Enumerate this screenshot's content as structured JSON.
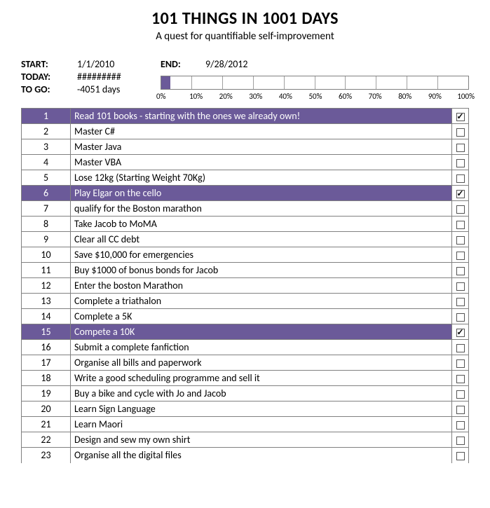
{
  "title": "101 THINGS IN 1001 DAYS",
  "subtitle": "A quest for quantifiable self-improvement",
  "meta": {
    "start_label": "START:",
    "start_value": "1/1/2010",
    "today_label": "TODAY:",
    "today_value": "#########",
    "togo_label": "TO GO:",
    "togo_value": "-4051 days",
    "end_label": "END:",
    "end_value": "9/28/2012"
  },
  "progress": {
    "ticks": [
      "0%",
      "10%",
      "20%",
      "30%",
      "40%",
      "50%",
      "60%",
      "70%",
      "80%",
      "90%",
      "100%"
    ],
    "fill_percent": 3
  },
  "items": [
    {
      "n": 1,
      "text": "Read 101 books - starting with the ones we already own!",
      "done": true
    },
    {
      "n": 2,
      "text": "Master C#",
      "done": false
    },
    {
      "n": 3,
      "text": "Master Java",
      "done": false
    },
    {
      "n": 4,
      "text": "Master VBA",
      "done": false
    },
    {
      "n": 5,
      "text": "Lose 12kg (Starting Weight 70Kg)",
      "done": false
    },
    {
      "n": 6,
      "text": "Play Elgar on the cello",
      "done": true
    },
    {
      "n": 7,
      "text": "qualify for the Boston marathon",
      "done": false
    },
    {
      "n": 8,
      "text": "Take Jacob to MoMA",
      "done": false
    },
    {
      "n": 9,
      "text": "Clear all CC debt",
      "done": false
    },
    {
      "n": 10,
      "text": "Save $10,000 for emergencies",
      "done": false
    },
    {
      "n": 11,
      "text": "Buy $1000 of bonus bonds for Jacob",
      "done": false
    },
    {
      "n": 12,
      "text": "Enter the boston Marathon",
      "done": false
    },
    {
      "n": 13,
      "text": "Complete a triathalon",
      "done": false
    },
    {
      "n": 14,
      "text": "Complete a 5K",
      "done": false
    },
    {
      "n": 15,
      "text": "Compete a 10K",
      "done": true
    },
    {
      "n": 16,
      "text": "Submit a complete fanfiction",
      "done": false
    },
    {
      "n": 17,
      "text": "Organise all bills and paperwork",
      "done": false
    },
    {
      "n": 18,
      "text": "Write a good scheduling programme and sell it",
      "done": false
    },
    {
      "n": 19,
      "text": "Buy a bike and cycle with Jo and Jacob",
      "done": false
    },
    {
      "n": 20,
      "text": "Learn Sign Language",
      "done": false
    },
    {
      "n": 21,
      "text": "Learn Maori",
      "done": false
    },
    {
      "n": 22,
      "text": "Design and sew my own shirt",
      "done": false
    },
    {
      "n": 23,
      "text": "Organise all the digital files",
      "done": false
    }
  ]
}
